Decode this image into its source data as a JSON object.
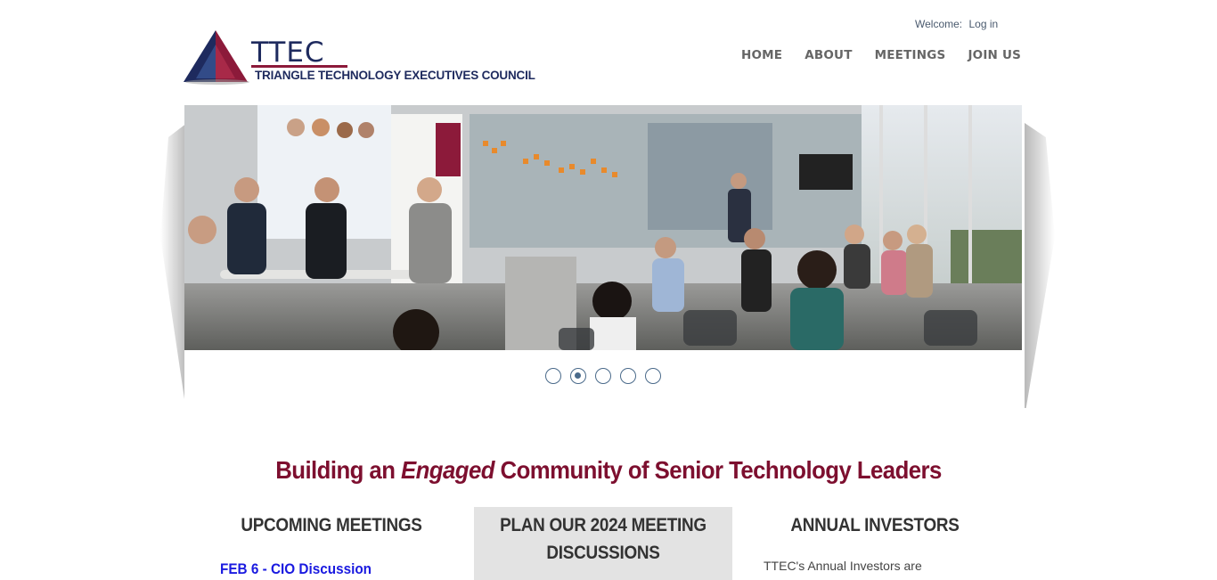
{
  "header": {
    "welcome_label": "Welcome:",
    "login_label": "Log in",
    "logo_title": "TTEC",
    "logo_subtitle": "TRIANGLE TECHNOLOGY EXECUTIVES COUNCIL"
  },
  "nav": {
    "items": [
      "HOME",
      "ABOUT",
      "MEETINGS",
      "JOIN US"
    ]
  },
  "slider": {
    "slide_count": 5,
    "active_index": 1
  },
  "headline": {
    "before": "Building an",
    "emphasis": "Engaged",
    "after": "Community of Senior Technology Leaders"
  },
  "columns": {
    "upcoming": {
      "title": "UPCOMING MEETINGS",
      "meeting_link": "FEB 6 - CIO Discussion"
    },
    "plan": {
      "title_line1": "PLAN OUR 2024 MEETING",
      "title_line2": "DISCUSSIONS"
    },
    "investors": {
      "title": "ANNUAL INVESTORS",
      "text": "TTEC's Annual Investors are"
    }
  },
  "colors": {
    "brand_navy": "#1e2a5e",
    "brand_maroon": "#7d0f2f",
    "link_blue": "#1a1ae0",
    "nav_gray": "#666666"
  }
}
